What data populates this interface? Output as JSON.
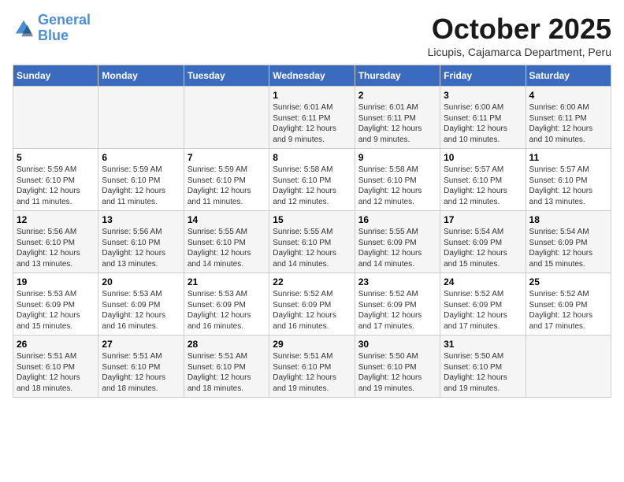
{
  "logo": {
    "line1": "General",
    "line2": "Blue"
  },
  "title": "October 2025",
  "subtitle": "Licupis, Cajamarca Department, Peru",
  "headers": [
    "Sunday",
    "Monday",
    "Tuesday",
    "Wednesday",
    "Thursday",
    "Friday",
    "Saturday"
  ],
  "weeks": [
    [
      {
        "day": "",
        "info": ""
      },
      {
        "day": "",
        "info": ""
      },
      {
        "day": "",
        "info": ""
      },
      {
        "day": "1",
        "info": "Sunrise: 6:01 AM\nSunset: 6:11 PM\nDaylight: 12 hours and 9 minutes."
      },
      {
        "day": "2",
        "info": "Sunrise: 6:01 AM\nSunset: 6:11 PM\nDaylight: 12 hours and 9 minutes."
      },
      {
        "day": "3",
        "info": "Sunrise: 6:00 AM\nSunset: 6:11 PM\nDaylight: 12 hours and 10 minutes."
      },
      {
        "day": "4",
        "info": "Sunrise: 6:00 AM\nSunset: 6:11 PM\nDaylight: 12 hours and 10 minutes."
      }
    ],
    [
      {
        "day": "5",
        "info": "Sunrise: 5:59 AM\nSunset: 6:10 PM\nDaylight: 12 hours and 11 minutes."
      },
      {
        "day": "6",
        "info": "Sunrise: 5:59 AM\nSunset: 6:10 PM\nDaylight: 12 hours and 11 minutes."
      },
      {
        "day": "7",
        "info": "Sunrise: 5:59 AM\nSunset: 6:10 PM\nDaylight: 12 hours and 11 minutes."
      },
      {
        "day": "8",
        "info": "Sunrise: 5:58 AM\nSunset: 6:10 PM\nDaylight: 12 hours and 12 minutes."
      },
      {
        "day": "9",
        "info": "Sunrise: 5:58 AM\nSunset: 6:10 PM\nDaylight: 12 hours and 12 minutes."
      },
      {
        "day": "10",
        "info": "Sunrise: 5:57 AM\nSunset: 6:10 PM\nDaylight: 12 hours and 12 minutes."
      },
      {
        "day": "11",
        "info": "Sunrise: 5:57 AM\nSunset: 6:10 PM\nDaylight: 12 hours and 13 minutes."
      }
    ],
    [
      {
        "day": "12",
        "info": "Sunrise: 5:56 AM\nSunset: 6:10 PM\nDaylight: 12 hours and 13 minutes."
      },
      {
        "day": "13",
        "info": "Sunrise: 5:56 AM\nSunset: 6:10 PM\nDaylight: 12 hours and 13 minutes."
      },
      {
        "day": "14",
        "info": "Sunrise: 5:55 AM\nSunset: 6:10 PM\nDaylight: 12 hours and 14 minutes."
      },
      {
        "day": "15",
        "info": "Sunrise: 5:55 AM\nSunset: 6:10 PM\nDaylight: 12 hours and 14 minutes."
      },
      {
        "day": "16",
        "info": "Sunrise: 5:55 AM\nSunset: 6:09 PM\nDaylight: 12 hours and 14 minutes."
      },
      {
        "day": "17",
        "info": "Sunrise: 5:54 AM\nSunset: 6:09 PM\nDaylight: 12 hours and 15 minutes."
      },
      {
        "day": "18",
        "info": "Sunrise: 5:54 AM\nSunset: 6:09 PM\nDaylight: 12 hours and 15 minutes."
      }
    ],
    [
      {
        "day": "19",
        "info": "Sunrise: 5:53 AM\nSunset: 6:09 PM\nDaylight: 12 hours and 15 minutes."
      },
      {
        "day": "20",
        "info": "Sunrise: 5:53 AM\nSunset: 6:09 PM\nDaylight: 12 hours and 16 minutes."
      },
      {
        "day": "21",
        "info": "Sunrise: 5:53 AM\nSunset: 6:09 PM\nDaylight: 12 hours and 16 minutes."
      },
      {
        "day": "22",
        "info": "Sunrise: 5:52 AM\nSunset: 6:09 PM\nDaylight: 12 hours and 16 minutes."
      },
      {
        "day": "23",
        "info": "Sunrise: 5:52 AM\nSunset: 6:09 PM\nDaylight: 12 hours and 17 minutes."
      },
      {
        "day": "24",
        "info": "Sunrise: 5:52 AM\nSunset: 6:09 PM\nDaylight: 12 hours and 17 minutes."
      },
      {
        "day": "25",
        "info": "Sunrise: 5:52 AM\nSunset: 6:09 PM\nDaylight: 12 hours and 17 minutes."
      }
    ],
    [
      {
        "day": "26",
        "info": "Sunrise: 5:51 AM\nSunset: 6:10 PM\nDaylight: 12 hours and 18 minutes."
      },
      {
        "day": "27",
        "info": "Sunrise: 5:51 AM\nSunset: 6:10 PM\nDaylight: 12 hours and 18 minutes."
      },
      {
        "day": "28",
        "info": "Sunrise: 5:51 AM\nSunset: 6:10 PM\nDaylight: 12 hours and 18 minutes."
      },
      {
        "day": "29",
        "info": "Sunrise: 5:51 AM\nSunset: 6:10 PM\nDaylight: 12 hours and 19 minutes."
      },
      {
        "day": "30",
        "info": "Sunrise: 5:50 AM\nSunset: 6:10 PM\nDaylight: 12 hours and 19 minutes."
      },
      {
        "day": "31",
        "info": "Sunrise: 5:50 AM\nSunset: 6:10 PM\nDaylight: 12 hours and 19 minutes."
      },
      {
        "day": "",
        "info": ""
      }
    ]
  ]
}
